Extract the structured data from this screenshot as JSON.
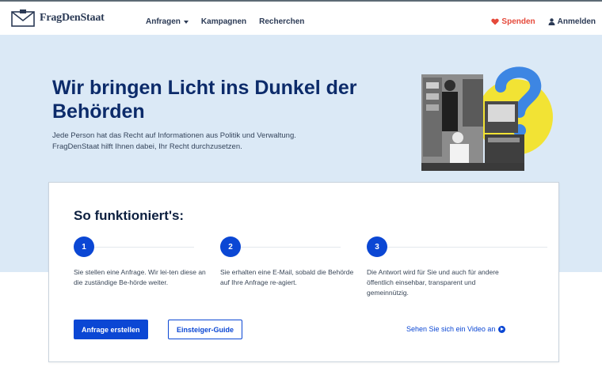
{
  "header": {
    "brand": "FragDenStaat",
    "nav": [
      {
        "label": "Anfragen",
        "has_dropdown": true
      },
      {
        "label": "Kampagnen",
        "has_dropdown": false
      },
      {
        "label": "Recherchen",
        "has_dropdown": false
      }
    ],
    "donate_label": "Spenden",
    "donate_icon": "heart-icon",
    "login_label": "Anmelden",
    "login_icon": "user-icon"
  },
  "hero": {
    "title": "Wir bringen Licht ins Dunkel der Behörden",
    "subtitle_line1": "Jede Person hat das Recht auf Informationen aus Politik und Verwaltung.",
    "subtitle_line2": "FragDenStaat hilft Ihnen dabei, Ihr Recht durchzusetzen.",
    "illustration_icon": "question-mark-icon"
  },
  "how_it_works": {
    "title": "So funktioniert's:",
    "steps": [
      {
        "number": "1",
        "text": "Sie stellen eine Anfrage. Wir lei-ten diese an die zuständige Be-hörde weiter."
      },
      {
        "number": "2",
        "text": "Sie erhalten eine E-Mail, sobald die Behörde auf Ihre Anfrage re-agiert."
      },
      {
        "number": "3",
        "text": "Die Antwort wird für Sie und auch für andere öffentlich einsehbar, transparent und gemeinnützig."
      }
    ],
    "primary_button": "Anfrage erstellen",
    "secondary_button": "Einsteiger-Guide",
    "video_link": "Sehen Sie sich ein Video an",
    "video_icon": "play-circle-icon"
  },
  "colors": {
    "accent": "#0b47d4",
    "hero_bg": "#dbe9f6",
    "donate": "#e5493a",
    "yellow": "#f2e334"
  }
}
